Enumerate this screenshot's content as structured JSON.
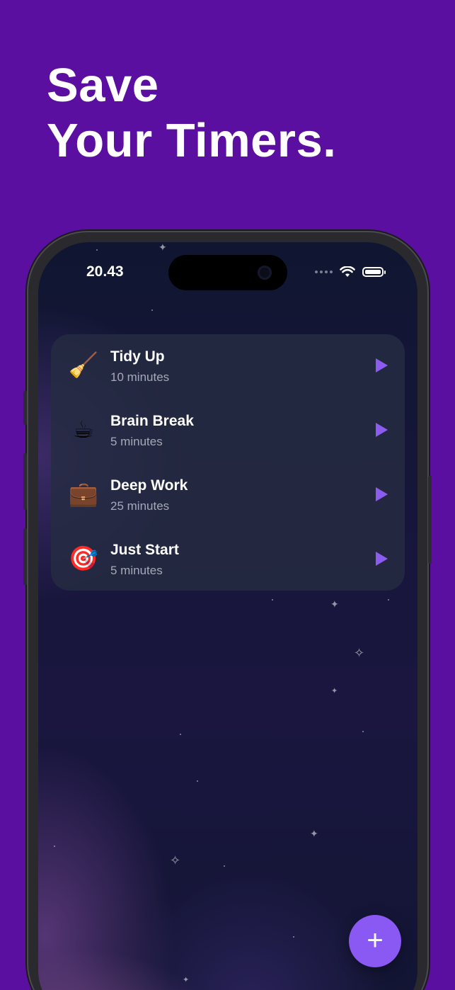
{
  "headline": {
    "line1": "Save",
    "line2": "Your Timers."
  },
  "status_bar": {
    "time": "20.43",
    "icons": [
      "signal-dots-icon",
      "wifi-icon",
      "battery-icon"
    ]
  },
  "timers": [
    {
      "emoji": "🧹",
      "title": "Tidy Up",
      "duration": "10 minutes",
      "icon": "broom-icon"
    },
    {
      "emoji": "☕",
      "title": "Brain Break",
      "duration": "5 minutes",
      "icon": "coffee-icon"
    },
    {
      "emoji": "💼",
      "title": "Deep Work",
      "duration": "25 minutes",
      "icon": "briefcase-icon"
    },
    {
      "emoji": "🎯",
      "title": "Just Start",
      "duration": "5 minutes",
      "icon": "target-icon"
    }
  ],
  "fab": {
    "label": "+",
    "icon": "plus-icon"
  },
  "colors": {
    "background": "#5a0fa1",
    "accent": "#8a58f3",
    "card": "#262c42",
    "text_secondary": "#a7a9b8"
  }
}
